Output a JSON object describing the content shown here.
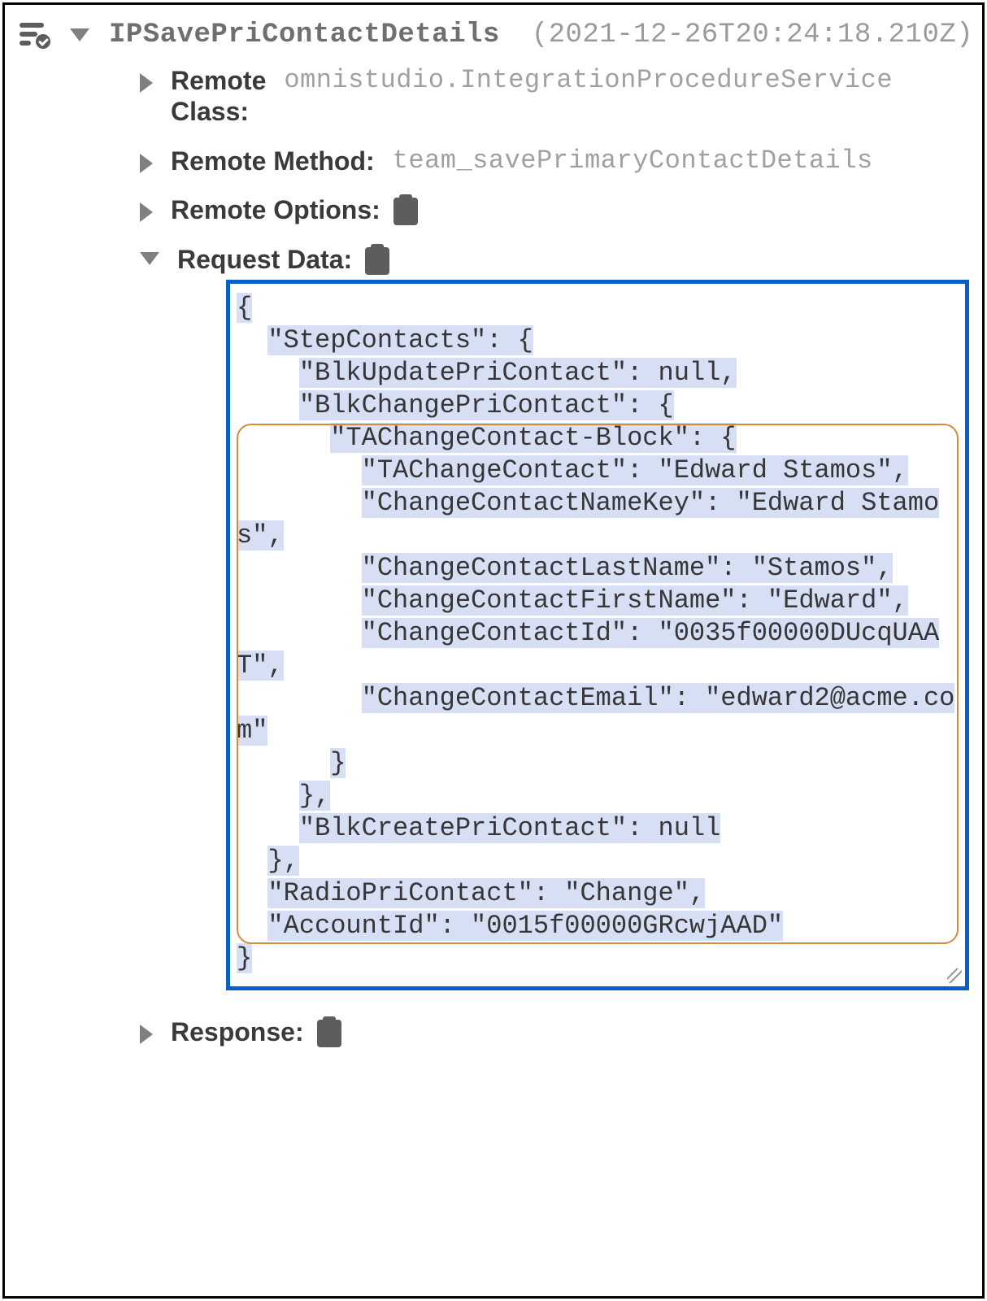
{
  "header": {
    "name": "IPSavePriContactDetails",
    "timestamp": "(2021-12-26T20:24:18.210Z)"
  },
  "remote_class": {
    "label": "Remote Class:",
    "value": "omnistudio.IntegrationProcedureService"
  },
  "remote_method": {
    "label": "Remote Method:",
    "value": "team_savePrimaryContactDetails"
  },
  "remote_options": {
    "label": "Remote Options:"
  },
  "request_data": {
    "label": "Request Data:"
  },
  "response": {
    "label": "Response:"
  },
  "request_json_lines": [
    "{",
    "  \"StepContacts\": {",
    "    \"BlkUpdatePriContact\": null,",
    "    \"BlkChangePriContact\": {",
    "      \"TAChangeContact-Block\": {",
    "        \"TAChangeContact\": \"Edward Stamos\",",
    "        \"ChangeContactNameKey\": \"Edward Stamos\",",
    "        \"ChangeContactLastName\": \"Stamos\",",
    "        \"ChangeContactFirstName\": \"Edward\",",
    "        \"ChangeContactId\": \"0035f00000DUcqUAAT\",",
    "        \"ChangeContactEmail\": \"edward2@acme.com\"",
    "      }",
    "    },",
    "    \"BlkCreatePriContact\": null",
    "  },",
    "  \"RadioPriContact\": \"Change\",",
    "  \"AccountId\": \"0015f00000GRcwjAAD\"",
    "}"
  ],
  "request_json_value": {
    "StepContacts": {
      "BlkUpdatePriContact": null,
      "BlkChangePriContact": {
        "TAChangeContact-Block": {
          "TAChangeContact": "Edward Stamos",
          "ChangeContactNameKey": "Edward Stamos",
          "ChangeContactLastName": "Stamos",
          "ChangeContactFirstName": "Edward",
          "ChangeContactId": "0035f00000DUcqUAAT",
          "ChangeContactEmail": "edward2@acme.com"
        }
      },
      "BlkCreatePriContact": null
    },
    "RadioPriContact": "Change",
    "AccountId": "0015f00000GRcwjAAD"
  }
}
